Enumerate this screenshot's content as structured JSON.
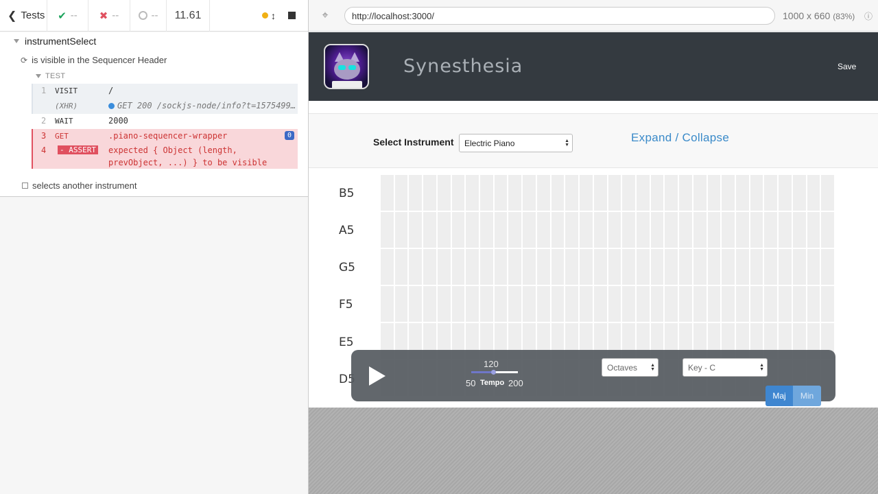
{
  "reporter": {
    "tests_label": "Tests",
    "passed": "--",
    "failed": "--",
    "pending": "--",
    "duration": "11.61",
    "suite_title": "instrumentSelect",
    "test1_title": "is visible in the Sequencer Header",
    "test_header": "TEST",
    "commands": [
      {
        "num": "1",
        "name": "visit",
        "message": "/"
      },
      {
        "num": "",
        "name": "(xhr)",
        "message": "GET 200 /sockjs-node/info?t=1575499…"
      },
      {
        "num": "2",
        "name": "wait",
        "message": "2000"
      },
      {
        "num": "3",
        "name": "get",
        "message": ".piano-sequencer-wrapper",
        "badge": "0"
      },
      {
        "num": "4",
        "name": "- ASSERT",
        "message_line1": "expected { Object (length,",
        "message_line2": "prevObject, ...) } to be visible"
      }
    ],
    "test2_title": "selects another instrument"
  },
  "aut": {
    "url": "http://localhost:3000/",
    "viewport": "1000 x 660",
    "scale": "(83%)"
  },
  "app": {
    "title": "Synesthesia",
    "save_label": "Save",
    "select_instrument_label": "Select Instrument",
    "instrument_value": "Electric Piano",
    "expand_label": "Expand / Collapse",
    "notes": [
      "B5",
      "A5",
      "G5",
      "F5",
      "E5",
      "D5"
    ],
    "tempo_value": "120",
    "tempo_min": "50",
    "tempo_label": "Tempo",
    "tempo_max": "200",
    "octaves_value": "Octaves",
    "key_value": "Key - C",
    "major_label": "Maj",
    "minor_label": "Min",
    "tempo_fraction": 0.467
  },
  "colors": {
    "header_bg": "#343a40",
    "link": "#3a8ac9",
    "error_bg": "#f9d7da",
    "error_accent": "#e0505f",
    "pass": "#1ba35b",
    "fail": "#e0505f"
  }
}
